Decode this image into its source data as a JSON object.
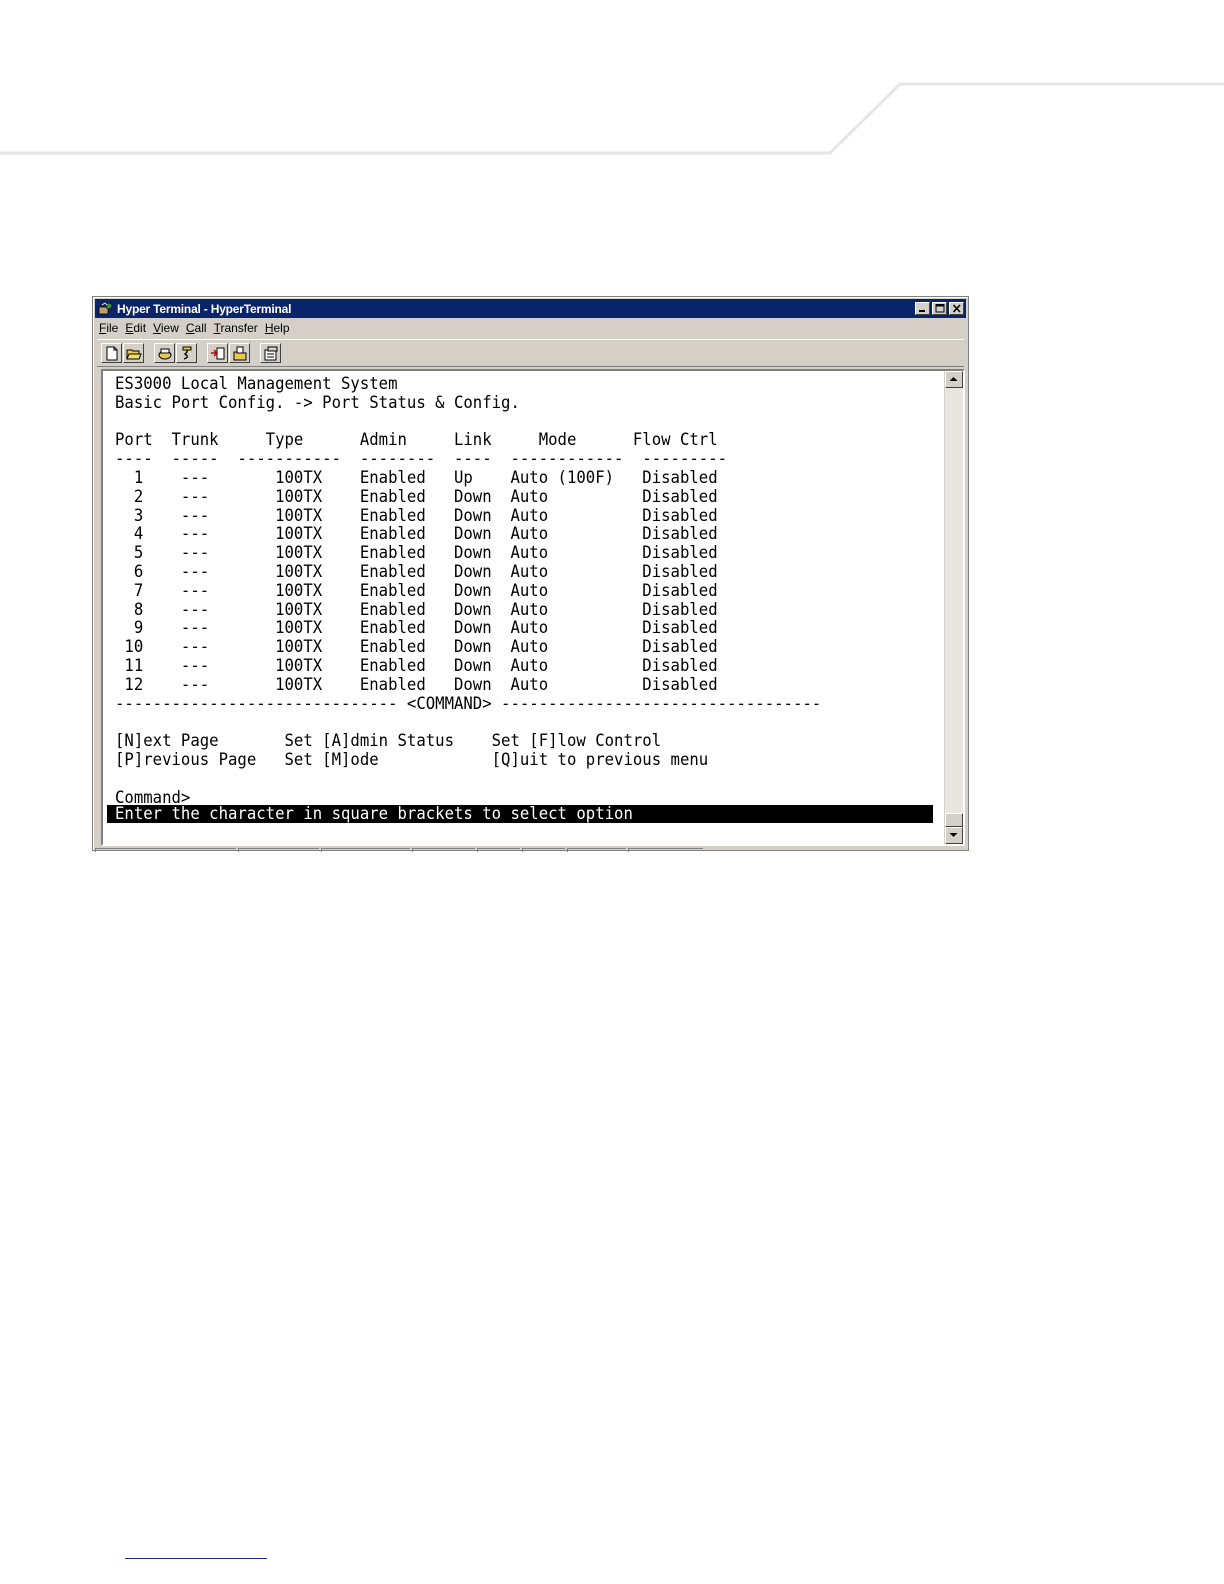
{
  "window": {
    "title": "Hyper Terminal - HyperTerminal",
    "menu": [
      {
        "label": "File",
        "key": "F",
        "rest": "ile"
      },
      {
        "label": "Edit",
        "key": "E",
        "rest": "dit"
      },
      {
        "label": "View",
        "key": "V",
        "rest": "iew"
      },
      {
        "label": "Call",
        "key": "C",
        "rest": "all"
      },
      {
        "label": "Transfer",
        "key": "T",
        "rest": "ransfer"
      },
      {
        "label": "Help",
        "key": "H",
        "rest": "elp"
      }
    ],
    "toolbar_icons": [
      "new-icon",
      "open-icon",
      "connect-icon",
      "disconnect-icon",
      "send-icon",
      "receive-icon",
      "properties-icon"
    ]
  },
  "terminal": {
    "lines": [
      "ES3000 Local Management System",
      "Basic Port Config. -> Port Status & Config.",
      "",
      "Port  Trunk     Type      Admin     Link     Mode      Flow Ctrl",
      "----  -----  -----------  --------  ----  ------------  ---------",
      "  1    ---       100TX    Enabled   Up    Auto (100F)   Disabled",
      "  2    ---       100TX    Enabled   Down  Auto          Disabled",
      "  3    ---       100TX    Enabled   Down  Auto          Disabled",
      "  4    ---       100TX    Enabled   Down  Auto          Disabled",
      "  5    ---       100TX    Enabled   Down  Auto          Disabled",
      "  6    ---       100TX    Enabled   Down  Auto          Disabled",
      "  7    ---       100TX    Enabled   Down  Auto          Disabled",
      "  8    ---       100TX    Enabled   Down  Auto          Disabled",
      "  9    ---       100TX    Enabled   Down  Auto          Disabled",
      " 10    ---       100TX    Enabled   Down  Auto          Disabled",
      " 11    ---       100TX    Enabled   Down  Auto          Disabled",
      " 12    ---       100TX    Enabled   Down  Auto          Disabled",
      "------------------------------ <COMMAND> ----------------------------------",
      "",
      "[N]ext Page       Set [A]dmin Status    Set [F]low Control",
      "[P]revious Page   Set [M]ode            [Q]uit to previous menu",
      "",
      "Command> _"
    ],
    "status_message": "Enter the character in square brackets to select option"
  }
}
